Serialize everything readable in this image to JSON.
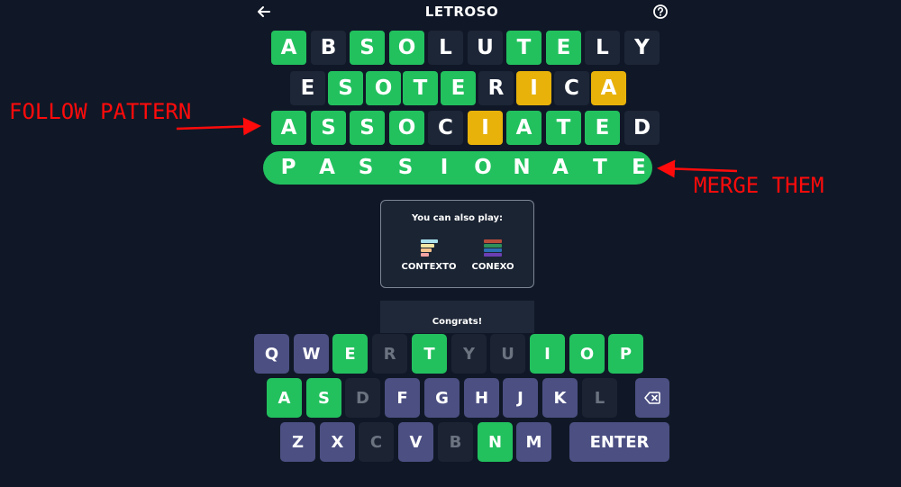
{
  "header": {
    "title": "LETROSO"
  },
  "colors": {
    "correct": "#22c15e",
    "present": "#e8b20a",
    "absent": "#1d2637",
    "key": "#4b4f82",
    "annotation": "#ff0b0b"
  },
  "board": {
    "rows": [
      {
        "letters": [
          "A",
          "B",
          "S",
          "O",
          "L",
          "U",
          "T",
          "E",
          "L",
          "Y"
        ],
        "states": [
          "correct",
          "absent",
          "correct",
          "correct",
          "absent",
          "absent",
          "correct",
          "correct",
          "absent",
          "absent"
        ]
      },
      {
        "letters": [
          "E",
          "S",
          "O",
          "T",
          "E",
          "R",
          "I",
          "C",
          "A"
        ],
        "states": [
          "absent",
          "correct",
          "correct",
          "correct",
          "correct",
          "absent",
          "present",
          "absent",
          "present"
        ]
      },
      {
        "letters": [
          "A",
          "S",
          "S",
          "O",
          "C",
          "I",
          "A",
          "T",
          "E",
          "D"
        ],
        "states": [
          "correct",
          "correct",
          "correct",
          "correct",
          "absent",
          "present",
          "correct",
          "correct",
          "correct",
          "absent"
        ]
      }
    ],
    "solution": [
      "P",
      "A",
      "S",
      "S",
      "I",
      "O",
      "N",
      "A",
      "T",
      "E"
    ]
  },
  "annotations": {
    "left": "FOLLOW PATTERN",
    "right": "MERGE THEM"
  },
  "promo": {
    "title": "You can also play:",
    "games": [
      {
        "label": "CONTEXTO",
        "icon": "contexto-icon"
      },
      {
        "label": "CONEXO",
        "icon": "conexo-icon"
      }
    ]
  },
  "congrats": "Congrats!",
  "keyboard": {
    "rows": [
      [
        {
          "k": "Q",
          "s": "gray"
        },
        {
          "k": "W",
          "s": "gray"
        },
        {
          "k": "E",
          "s": "green"
        },
        {
          "k": "R",
          "s": "dim"
        },
        {
          "k": "T",
          "s": "green"
        },
        {
          "k": "Y",
          "s": "dim"
        },
        {
          "k": "U",
          "s": "dim"
        },
        {
          "k": "I",
          "s": "green"
        },
        {
          "k": "O",
          "s": "green"
        },
        {
          "k": "P",
          "s": "green"
        }
      ],
      [
        {
          "k": "A",
          "s": "green"
        },
        {
          "k": "S",
          "s": "green"
        },
        {
          "k": "D",
          "s": "dim"
        },
        {
          "k": "F",
          "s": "gray"
        },
        {
          "k": "G",
          "s": "gray"
        },
        {
          "k": "H",
          "s": "gray"
        },
        {
          "k": "J",
          "s": "gray"
        },
        {
          "k": "K",
          "s": "gray"
        },
        {
          "k": "L",
          "s": "dim"
        }
      ],
      [
        {
          "k": "Z",
          "s": "gray"
        },
        {
          "k": "X",
          "s": "gray"
        },
        {
          "k": "C",
          "s": "dim"
        },
        {
          "k": "V",
          "s": "gray"
        },
        {
          "k": "B",
          "s": "dim"
        },
        {
          "k": "N",
          "s": "green"
        },
        {
          "k": "M",
          "s": "gray"
        }
      ]
    ],
    "enter": "ENTER"
  }
}
